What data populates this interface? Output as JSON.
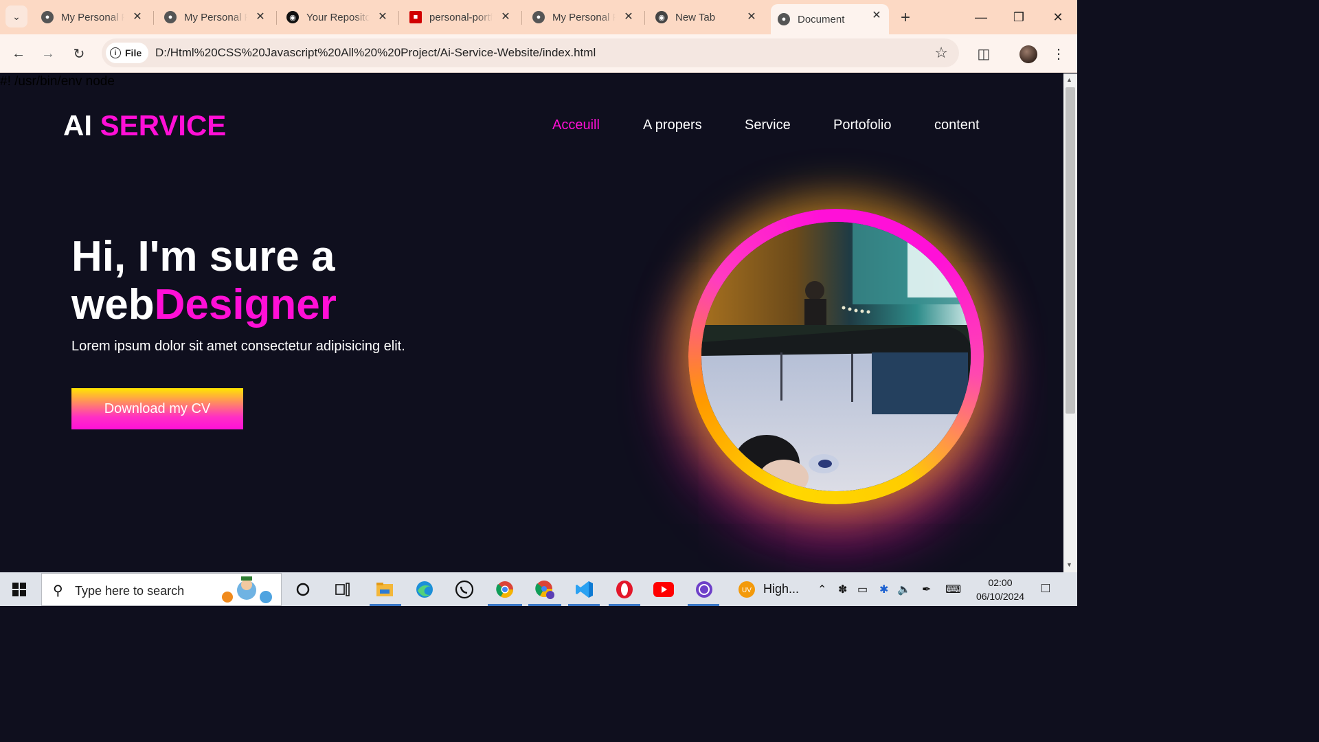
{
  "browser": {
    "tabs": [
      {
        "title": "My Personal Portfolio",
        "active": false
      },
      {
        "title": "My Personal Portfolio",
        "active": false
      },
      {
        "title": "Your Repositories",
        "active": false
      },
      {
        "title": "personal-portfolio",
        "active": false
      },
      {
        "title": "My Personal Portfolio",
        "active": false
      },
      {
        "title": "New Tab",
        "active": false
      },
      {
        "title": "Document",
        "active": true
      }
    ],
    "site_chip_label": "File",
    "url": "D:/Html%20CSS%20Javascript%20All%20%20Project/Ai-Service-Website/index.html",
    "accent_color": "#fcd9c4"
  },
  "page": {
    "shebang": "#! /usr/bin/env node",
    "logo": {
      "part1": "AI ",
      "part2": "SERVICE"
    },
    "nav": [
      "Acceuill",
      "A propers",
      "Service",
      "Portofolio",
      "content"
    ],
    "hero": {
      "line1": "Hi, I'm sure a",
      "line2_plain": "web",
      "line2_accent": "Designer",
      "subtitle": "Lorem ipsum dolor sit amet consectetur adipisicing elit.",
      "button": "Download my CV"
    },
    "colors": {
      "background": "#0f0f1e",
      "accent": "#ff0fd6",
      "button_top": "#ffe600"
    }
  },
  "taskbar": {
    "search_placeholder": "Type here to search",
    "weather_label": "High...",
    "time": "02:00",
    "date": "06/10/2024",
    "apps": [
      "cortana-icon",
      "task-view-icon",
      "file-explorer-icon",
      "edge-icon",
      "whatsapp-icon",
      "chrome-icon",
      "chrome-profile-icon",
      "vscode-icon",
      "opera-icon",
      "youtube-icon",
      "github-desktop-icon"
    ]
  }
}
